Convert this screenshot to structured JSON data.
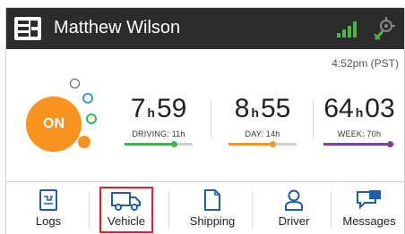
{
  "header": {
    "driver_name": "Matthew Wilson",
    "icons": [
      "app-logo-icon",
      "signal-strength-icon",
      "gps-icon"
    ]
  },
  "clock": {
    "time": "4:52pm (PST)"
  },
  "status": {
    "label": "ON",
    "color": "#f7931e"
  },
  "timers": [
    {
      "hours": "7",
      "unit": "h",
      "minutes": "59",
      "label": "DRIVING: 11h",
      "progress": 0.73,
      "color": "#3db54a"
    },
    {
      "hours": "8",
      "unit": "h",
      "minutes": "55",
      "label": "DAY: 14h",
      "progress": 0.64,
      "color": "#f7931e"
    },
    {
      "hours": "64",
      "unit": "h",
      "minutes": "03",
      "label": "WEEK: 70h",
      "progress": 0.92,
      "color": "#7b3fa0"
    }
  ],
  "nav": {
    "items": [
      {
        "label": "Logs",
        "icon": "logs-icon"
      },
      {
        "label": "Vehicle",
        "icon": "truck-icon",
        "selected": true
      },
      {
        "label": "Shipping",
        "icon": "document-icon"
      },
      {
        "label": "Driver",
        "icon": "person-icon"
      },
      {
        "label": "Messages",
        "icon": "message-icon"
      }
    ]
  },
  "colors": {
    "accent": "#1f5ea8",
    "header_bg": "#2b2b2b",
    "signal": "#4bb64a",
    "highlight": "#e02020"
  }
}
